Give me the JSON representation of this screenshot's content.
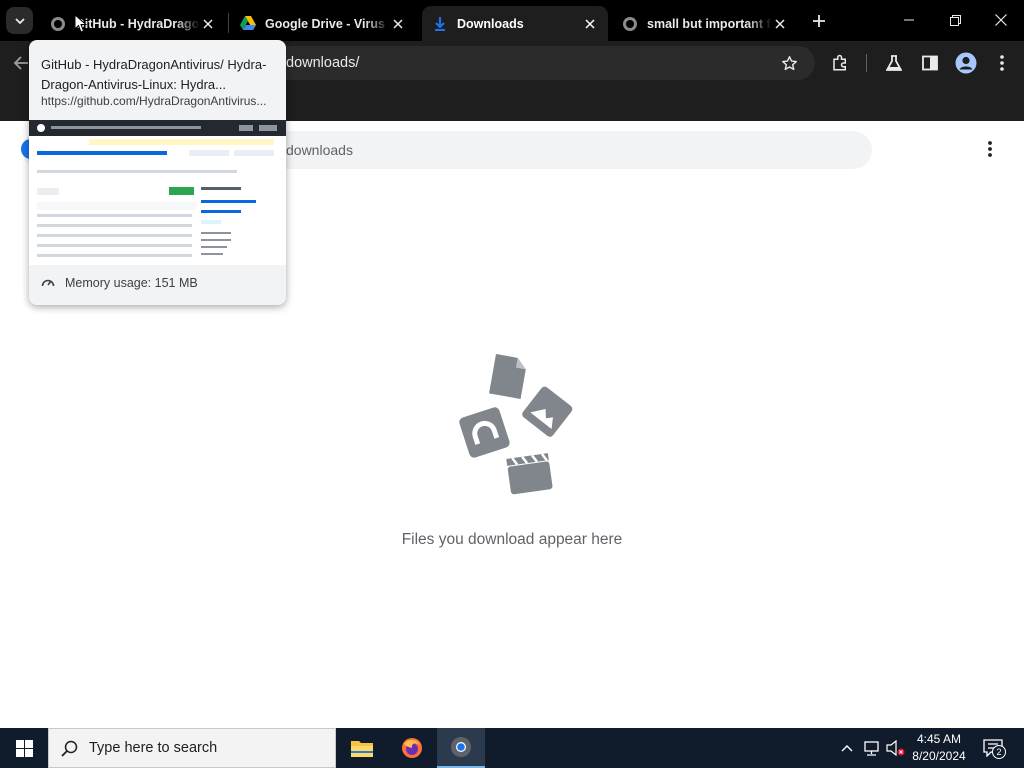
{
  "tabs": [
    {
      "title": "GitHub - HydraDragonAntivirus/Hydra-Dragon-Antivirus-Linux",
      "icon": "github-icon",
      "active": false
    },
    {
      "title": "Google Drive - Virus scan warning",
      "icon": "google-drive-icon",
      "active": false
    },
    {
      "title": "Downloads",
      "icon": "download-icon",
      "active": true
    },
    {
      "title": "small but important fixes",
      "icon": "github-icon",
      "active": false
    }
  ],
  "toolbar": {
    "url": "downloads/"
  },
  "hovercard": {
    "title": "GitHub - HydraDragonAntivirus/ Hydra-Dragon-Antivirus-Linux: Hydra...",
    "url": "https://github.com/HydraDragonAntivirus...",
    "memory": "Memory usage: 151 MB"
  },
  "page": {
    "search_placeholder": "downloads",
    "empty_message": "Files you download appear here"
  },
  "taskbar": {
    "search_placeholder": "Type here to search",
    "time": "4:45 AM",
    "date": "8/20/2024",
    "notification_count": "2"
  },
  "colors": {
    "tabstrip": "#000000",
    "toolbar": "#1e1e1e",
    "active_tab": "#1e1e1e",
    "taskbar": "#101c2c",
    "illustration": "#80868b"
  }
}
